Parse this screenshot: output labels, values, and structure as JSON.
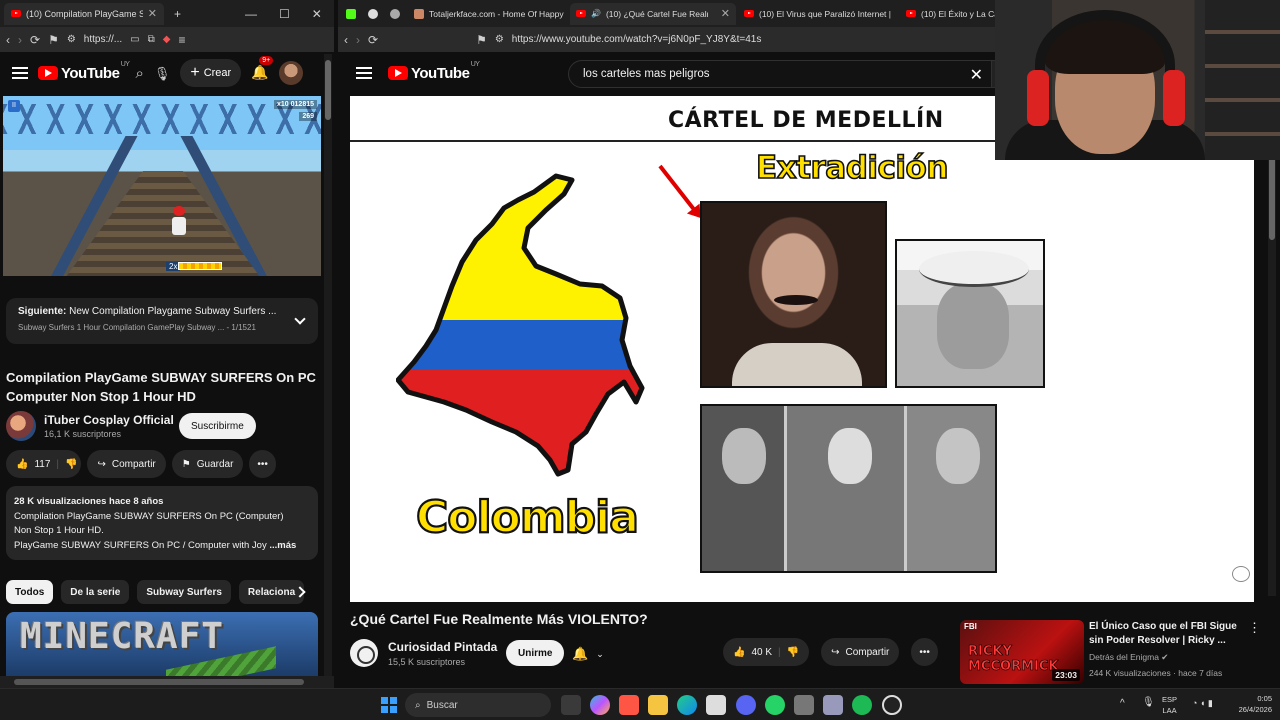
{
  "left_window": {
    "tabs": [
      {
        "label": "(10) Compilation PlayGame SUBWAY",
        "active": true
      }
    ],
    "url": "https://...",
    "header": {
      "logo": "YouTube",
      "region": "UY",
      "create_label": "Crear",
      "notif_count": "9+"
    },
    "game": {
      "score": "012815",
      "coins": "269",
      "multiplier": "x10",
      "boost": "2x"
    },
    "next": {
      "prefix": "Siguiente:",
      "title": "New Compilation Playgame Subway Surfers ...",
      "subtitle": "Subway Surfers 1 Hour Compilation GamePlay Subway ...",
      "position": "1/1521"
    },
    "video_title": "Compilation PlayGame SUBWAY SURFERS On PC Computer Non Stop 1 Hour HD",
    "channel": {
      "name": "iTuber Cosplay Official",
      "subs": "16,1 K suscriptores",
      "subscribe_label": "Suscribirme"
    },
    "actions": {
      "likes": "117",
      "share": "Compartir",
      "save": "Guardar"
    },
    "description": {
      "stats": "28 K visualizaciones  hace 8 años",
      "line1": "Compilation PlayGame SUBWAY SURFERS On PC (Computer)",
      "line2": "Non Stop 1 Hour HD.",
      "line3": "PlayGame SUBWAY SURFERS On PC / Computer with Joy",
      "more": "...más"
    },
    "chips": [
      "Todos",
      "De la serie",
      "Subway Surfers",
      "Relaciona"
    ],
    "rec_thumb_text": "MINECRAFT"
  },
  "right_window": {
    "tabs": [
      {
        "label": "Totaljerkface.com - Home Of Happy"
      },
      {
        "label": "(10) ¿Qué Cartel Fue Realmen",
        "active": true
      },
      {
        "label": "(10) El Virus que Paralizó Internet | Bi"
      },
      {
        "label": "(10) El Éxito y La Ca"
      }
    ],
    "url": "https://www.youtube.com/watch?v=j6N0pF_YJ8Y&t=41s",
    "header": {
      "logo": "YouTube",
      "region": "UY"
    },
    "search": {
      "value": "los carteles mas peligros"
    },
    "video_frame": {
      "heading": "CÁRTEL DE MEDELLÍN",
      "label_top": "Extradición",
      "label_country": "Colombia"
    },
    "video_title": "¿Qué Cartel Fue Realmente Más VIOLENTO?",
    "channel": {
      "name": "Curiosidad Pintada",
      "subs": "15,5 K suscriptores",
      "join_label": "Unirme"
    },
    "actions": {
      "likes": "40 K",
      "share": "Compartir"
    },
    "related": {
      "title": "El Único Caso que el FBI Sigue sin Poder Resolver | Ricky ...",
      "channel": "Detrás del Enigma",
      "meta": "244 K visualizaciones · hace 7 días",
      "duration": "23:03",
      "thumb_text": "RICKY MCCORMICK",
      "thumb_badge": "FBI"
    }
  },
  "taskbar": {
    "search_placeholder": "Buscar",
    "lang": "ESP",
    "lang2": "LAA",
    "time": "0:05",
    "date": "26/4/2026"
  }
}
